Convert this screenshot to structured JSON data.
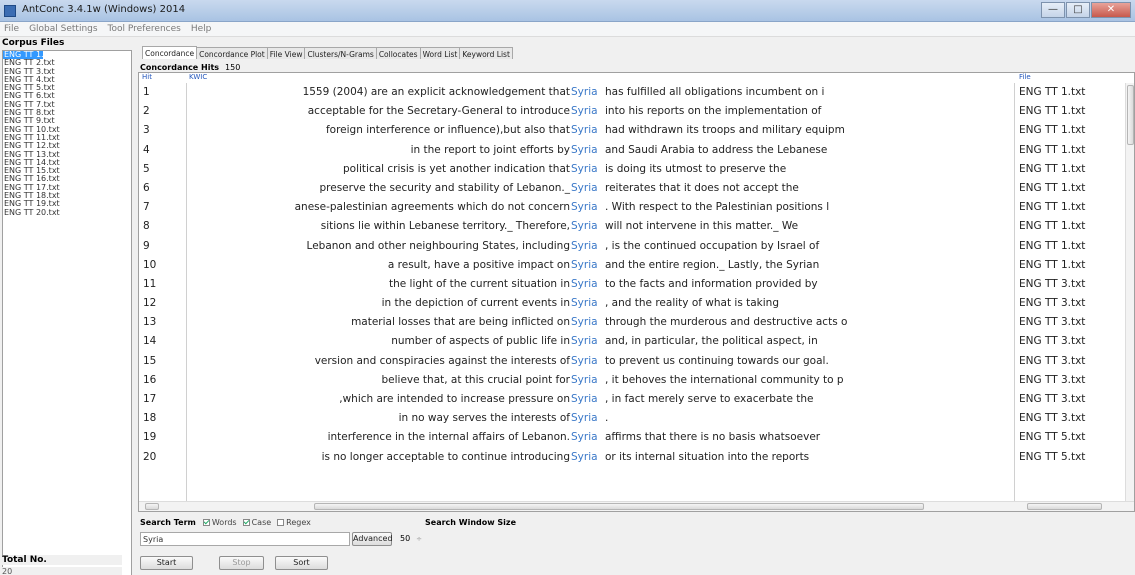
{
  "window": {
    "title": "AntConc 3.4.1w (Windows) 2014",
    "minimize": "—",
    "maximize": "□",
    "close": "✕"
  },
  "menu": [
    "File",
    "Global Settings",
    "Tool Preferences",
    "Help"
  ],
  "corpus": {
    "title": "Corpus Files",
    "files": [
      "ENG TT 1.txt",
      "ENG TT 2.txt",
      "ENG TT 3.txt",
      "ENG TT 4.txt",
      "ENG TT 5.txt",
      "ENG TT 6.txt",
      "ENG TT 7.txt",
      "ENG TT 8.txt",
      "ENG TT 9.txt",
      "ENG TT 10.txt",
      "ENG TT 11.txt",
      "ENG TT 12.txt",
      "ENG TT 13.txt",
      "ENG TT 14.txt",
      "ENG TT 15.txt",
      "ENG TT 16.txt",
      "ENG TT 17.txt",
      "ENG TT 18.txt",
      "ENG TT 19.txt",
      "ENG TT 20.txt"
    ],
    "selected_index": 0,
    "total_label": "Total No.",
    "total_value": "20"
  },
  "tabs": [
    "Concordance",
    "Concordance Plot",
    "File View",
    "Clusters/N-Grams",
    "Collocates",
    "Word List",
    "Keyword List"
  ],
  "active_tab": 0,
  "concordance": {
    "hits_label": "Concordance Hits",
    "hits_value": "150",
    "col_hit": "Hit",
    "col_kwic": "KWIC",
    "col_file": "File",
    "keyword": "Syria",
    "rows": [
      {
        "hit": "1",
        "left": "1559 (2004) are an explicit acknowledgement that",
        "right": "has fulfilled all obligations incumbent on i",
        "file": "ENG TT 1.txt"
      },
      {
        "hit": "2",
        "left": "acceptable for the Secretary-General to introduce",
        "right": "into his reports on the implementation of",
        "file": "ENG TT 1.txt"
      },
      {
        "hit": "3",
        "left": "foreign interference or influence),but also that",
        "right": "had withdrawn its troops and military equipm",
        "file": "ENG TT 1.txt"
      },
      {
        "hit": "4",
        "left": "in the report to joint efforts by",
        "right": "and Saudi Arabia to address the Lebanese",
        "file": "ENG TT 1.txt"
      },
      {
        "hit": "5",
        "left": "political crisis is yet another indication that",
        "right": "is doing its utmost to preserve the",
        "file": "ENG TT 1.txt"
      },
      {
        "hit": "6",
        "left": "preserve the security and stability of Lebanon._",
        "right": "reiterates that it does not accept the",
        "file": "ENG TT 1.txt"
      },
      {
        "hit": "7",
        "left": "anese-palestinian agreements which do not concern",
        "right": ". With respect to the Palestinian positions l",
        "file": "ENG TT 1.txt"
      },
      {
        "hit": "8",
        "left": "sitions lie within Lebanese territory._ Therefore,",
        "right": "will not intervene in this matter._ We",
        "file": "ENG TT 1.txt"
      },
      {
        "hit": "9",
        "left": "Lebanon and other neighbouring States, including",
        "right": ", is the continued occupation by Israel of",
        "file": "ENG TT 1.txt"
      },
      {
        "hit": "10",
        "left": "a result, have a positive impact on",
        "right": "and the entire region._ Lastly, the Syrian",
        "file": "ENG TT 1.txt"
      },
      {
        "hit": "11",
        "left": "the light of the current situation in",
        "right": "to the facts and information provided by",
        "file": "ENG TT 3.txt"
      },
      {
        "hit": "12",
        "left": "in the depiction of current events in",
        "right": ", and the reality of what is taking",
        "file": "ENG TT 3.txt"
      },
      {
        "hit": "13",
        "left": "material losses that are being inflicted on",
        "right": "through the murderous and destructive acts o",
        "file": "ENG TT 3.txt"
      },
      {
        "hit": "14",
        "left": "number of aspects of public life in",
        "right": "and, in particular, the political aspect, in",
        "file": "ENG TT 3.txt"
      },
      {
        "hit": "15",
        "left": "version and conspiracies against the interests of",
        "right": "to prevent us continuing towards our goal.",
        "file": "ENG TT 3.txt"
      },
      {
        "hit": "16",
        "left": "believe that, at this crucial point for",
        "right": ", it behoves the international community to p",
        "file": "ENG TT 3.txt"
      },
      {
        "hit": "17",
        "left": ",which are intended to increase pressure on",
        "right": ", in fact merely serve to exacerbate the",
        "file": "ENG TT 3.txt"
      },
      {
        "hit": "18",
        "left": "in no way serves the interests of",
        "right": ".",
        "file": "ENG TT 3.txt"
      },
      {
        "hit": "19",
        "left": "interference in the internal affairs of Lebanon.",
        "right": "affirms that there is no basis whatsoever",
        "file": "ENG TT 5.txt"
      },
      {
        "hit": "20",
        "left": "is no longer acceptable to continue introducing",
        "right": "or its internal situation into the reports",
        "file": "ENG TT 5.txt"
      }
    ]
  },
  "search": {
    "term_label": "Search Term",
    "words_label": "Words",
    "case_label": "Case",
    "regex_label": "Regex",
    "words_checked": true,
    "case_checked": true,
    "regex_checked": false,
    "window_size_label": "Search Window Size",
    "value": "Syria",
    "advanced_label": "Advanced",
    "window_size_value": "50",
    "stepper": "÷",
    "start_label": "Start",
    "stop_label": "Stop",
    "sort_label": "Sort"
  }
}
